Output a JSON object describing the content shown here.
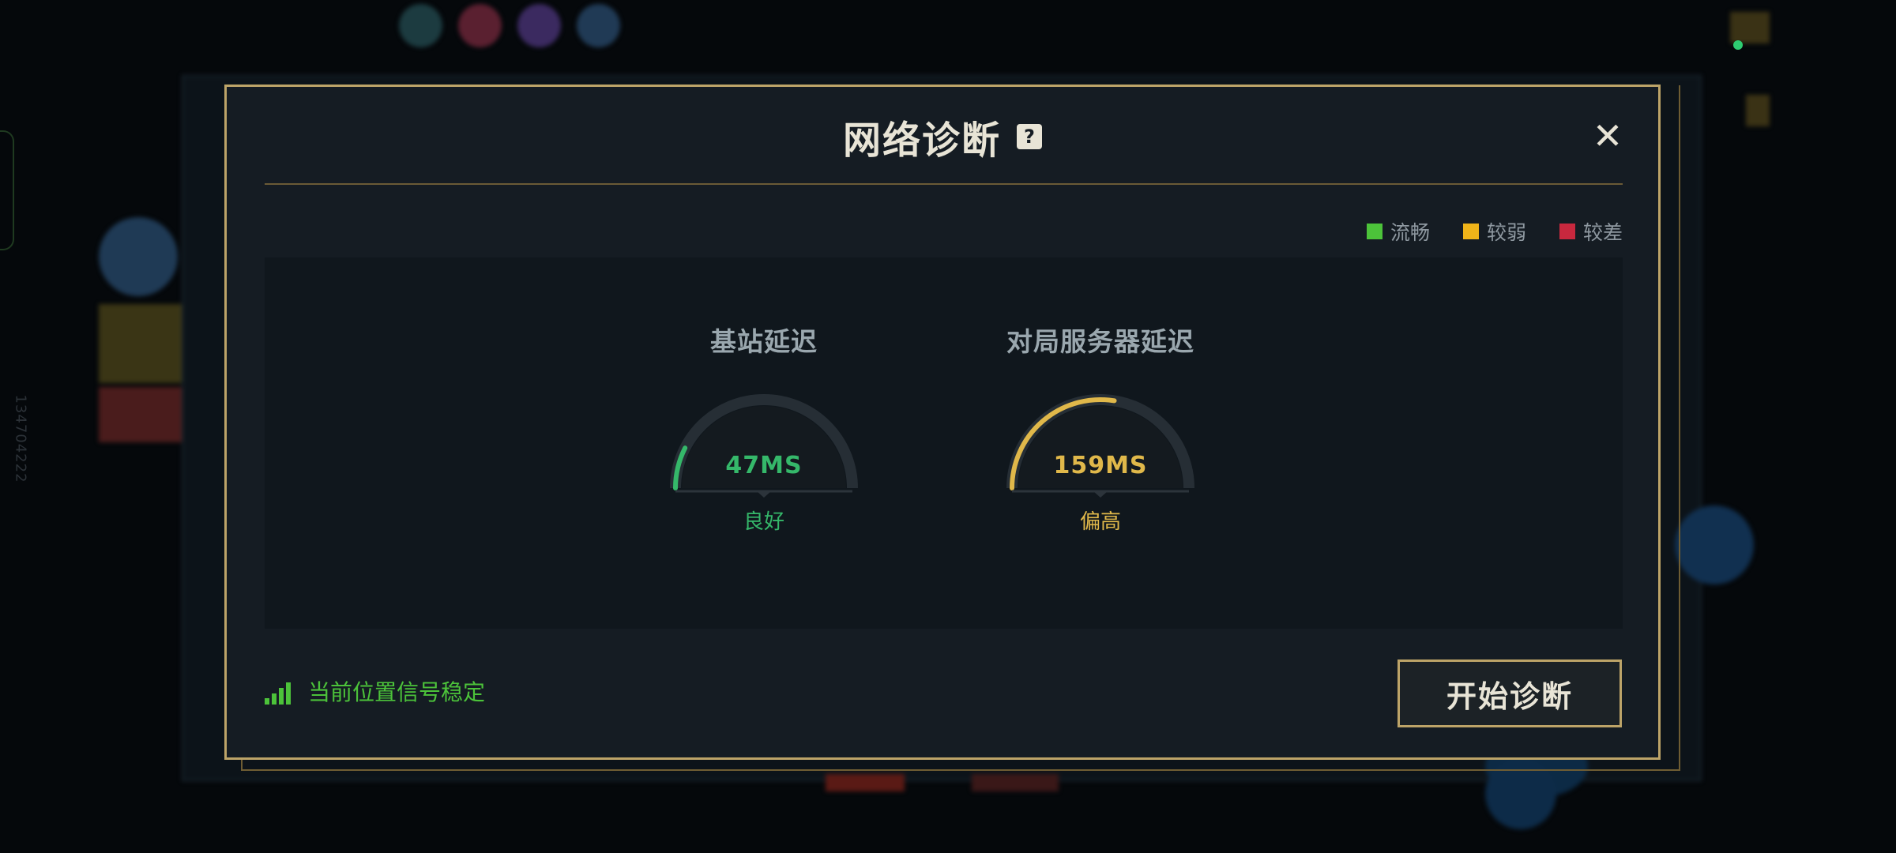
{
  "side_id_text": "134704222",
  "dialog": {
    "title": "网络诊断",
    "help_glyph": "?",
    "close_glyph": "✕"
  },
  "legend": [
    {
      "label": "流畅",
      "color": "#4cc33a"
    },
    {
      "label": "较弱",
      "color": "#f0b419"
    },
    {
      "label": "较差",
      "color": "#c8283e"
    }
  ],
  "gauges": [
    {
      "label": "基站延迟",
      "value": "47MS",
      "status": "良好",
      "color": "#35b86a",
      "fill_fraction": 0.15
    },
    {
      "label": "对局服务器延迟",
      "value": "159MS",
      "status": "偏高",
      "color": "#e0b84a",
      "fill_fraction": 0.55
    }
  ],
  "signal": {
    "text": "当前位置信号稳定",
    "icon": "signal-bars-icon",
    "level": 4,
    "max": 4
  },
  "start_button": {
    "label": "开始诊断"
  },
  "colors": {
    "accent_gold": "#bda468",
    "dialog_bg": "#151c23"
  }
}
